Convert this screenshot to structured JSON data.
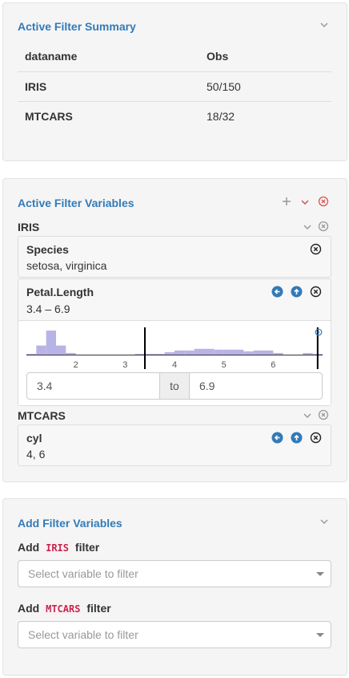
{
  "summary": {
    "title": "Active Filter Summary",
    "headers": [
      "dataname",
      "Obs"
    ],
    "rows": [
      {
        "name": "IRIS",
        "obs": "50/150"
      },
      {
        "name": "MTCARS",
        "obs": "18/32"
      }
    ]
  },
  "active": {
    "title": "Active Filter Variables",
    "groups": [
      {
        "name": "IRIS",
        "vars": [
          {
            "name": "Species",
            "value": "setosa, virginica"
          },
          {
            "name": "Petal.Length",
            "value": "3.4 – 6.9",
            "range_from": "3.4",
            "range_to_label": "to",
            "range_to": "6.9",
            "ticks": [
              "2",
              "3",
              "4",
              "5",
              "6"
            ]
          }
        ]
      },
      {
        "name": "MTCARS",
        "vars": [
          {
            "name": "cyl",
            "value": "4, 6"
          }
        ]
      }
    ]
  },
  "add": {
    "title": "Add Filter Variables",
    "sections": [
      {
        "prefix": "Add",
        "dataset": "IRIS",
        "suffix": "filter",
        "placeholder": "Select variable to filter"
      },
      {
        "prefix": "Add",
        "dataset": "MTCARS",
        "suffix": "filter",
        "placeholder": "Select variable to filter"
      }
    ]
  },
  "chart_data": {
    "type": "bar",
    "x": [
      1.1,
      1.3,
      1.5,
      1.7,
      1.9,
      3.3,
      3.5,
      3.7,
      3.9,
      4.1,
      4.3,
      4.5,
      4.7,
      4.9,
      5.1,
      5.3,
      5.5,
      5.7,
      5.9,
      6.1,
      6.7,
      6.9
    ],
    "values": [
      1,
      11,
      29,
      11,
      2,
      1,
      1,
      1,
      3,
      5,
      5,
      7,
      7,
      6,
      6,
      6,
      4,
      5,
      5,
      2,
      2,
      1
    ],
    "xlim": [
      1,
      7
    ],
    "ticks": [
      2,
      3,
      4,
      5,
      6
    ],
    "selected_range": [
      3.4,
      6.9
    ],
    "colors": {
      "bar": "#b8b3e6",
      "handle": "#000000",
      "axis": "#333333"
    }
  },
  "colors": {
    "accent": "#337ab7",
    "icon_blue": "#337ab7",
    "danger": "#d9534f",
    "code_red": "#c7254e"
  }
}
